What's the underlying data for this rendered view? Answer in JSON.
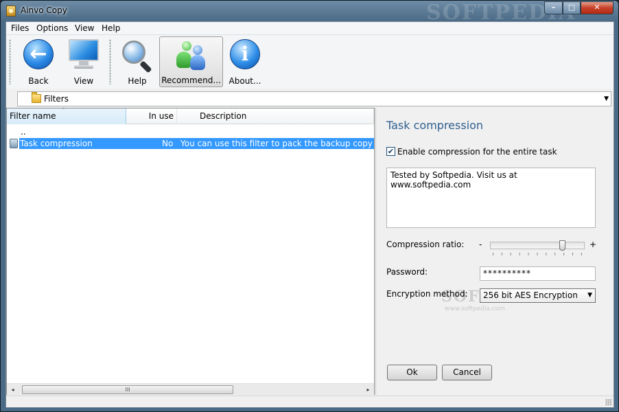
{
  "window": {
    "title": "Ainvo Copy",
    "background_watermark": "SOFTPEDIA",
    "controls": {
      "minimize": "–",
      "maximize": "□",
      "close": "✕"
    }
  },
  "menu": [
    "Files",
    "Options",
    "View",
    "Help"
  ],
  "toolbar": {
    "buttons": [
      {
        "label": "Back",
        "icon": "back-arrow-icon"
      },
      {
        "label": "View",
        "icon": "monitor-icon"
      },
      {
        "label": "Help",
        "icon": "magnifier-globe-icon"
      },
      {
        "label": "Recommend...",
        "icon": "people-icon"
      },
      {
        "label": "About...",
        "icon": "info-icon"
      }
    ]
  },
  "pathbar": {
    "label": "Filters",
    "icon": "folder-icon"
  },
  "list": {
    "columns": [
      "Filter name",
      "In use",
      "Description"
    ],
    "sort_indicator": "˄",
    "rows": [
      {
        "name": "..",
        "in_use": "",
        "description": ""
      },
      {
        "name": "Task compression",
        "in_use": "No",
        "description": "You can use this filter to pack the backup copy to"
      }
    ],
    "scroll_grip": "III",
    "scroll_left": "◂",
    "scroll_right": "▸"
  },
  "detail": {
    "title": "Task compression",
    "enable_checkbox": {
      "label": "Enable compression for the entire task",
      "checked": true,
      "mark": "✔"
    },
    "memo": "Tested by Softpedia. Visit us at www.softpedia.com",
    "compression_ratio_label": "Compression ratio:",
    "slider_minus": "-",
    "slider_plus": "+",
    "slider_level": 0.78,
    "password_label": "Password:",
    "password_value": "**********",
    "encryption_label": "Encryption method:",
    "encryption_value": "256 bit AES Encryption",
    "watermark": "SOFTPEDIA",
    "watermark_url": "www.softpedia.com",
    "ok_label": "Ok",
    "cancel_label": "Cancel"
  }
}
